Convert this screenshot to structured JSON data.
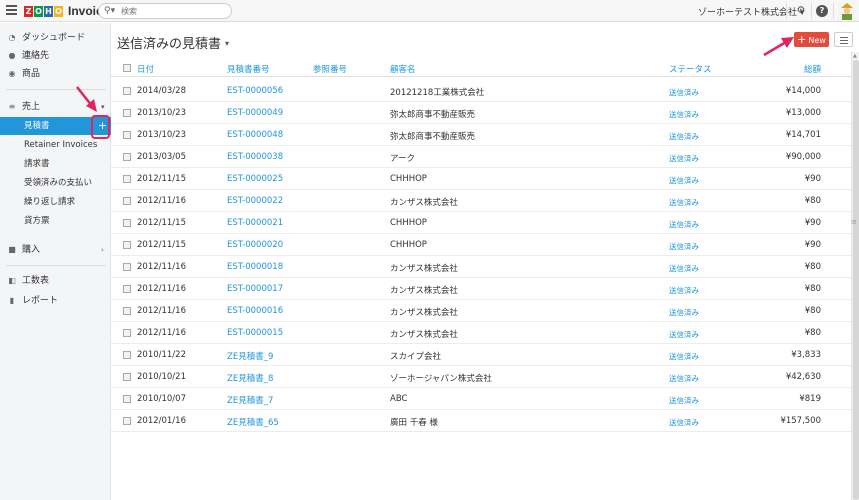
{
  "app": {
    "logo_letters": [
      "Z",
      "O",
      "H",
      "O"
    ],
    "name": "Invoice",
    "logo_colors": [
      "#e42527",
      "#089949",
      "#226db4",
      "#f9b21d"
    ]
  },
  "search": {
    "placeholder": "検索",
    "icon": "search-icon"
  },
  "org": {
    "name": "ゾーホーテスト株式会社 ▾"
  },
  "colors": {
    "accent": "#2196d9",
    "new_button": "#e34b3b",
    "highlight": "#e0245e"
  },
  "sidebar": {
    "items": [
      {
        "label": "ダッシュボード",
        "icon": "dashboard-icon"
      },
      {
        "label": "連絡先",
        "icon": "contacts-icon"
      },
      {
        "label": "商品",
        "icon": "items-icon"
      }
    ],
    "sales": {
      "label": "売上",
      "icon": "sales-icon"
    },
    "sales_sub": [
      "見積書",
      "Retainer Invoices",
      "請求書",
      "受領済みの支払い",
      "繰り返し請求",
      "貸方票"
    ],
    "purchases": {
      "label": "購入",
      "icon": "purchases-icon"
    },
    "timesheet": {
      "label": "工数表",
      "icon": "timesheet-icon"
    },
    "reports": {
      "label": "レポート",
      "icon": "reports-icon"
    }
  },
  "page": {
    "title": "送信済みの見積書",
    "new_label": "New"
  },
  "table": {
    "headers": {
      "date": "日付",
      "number": "見積書番号",
      "reference": "参照番号",
      "customer": "顧客名",
      "status": "ステータス",
      "amount": "総額"
    },
    "rows": [
      {
        "date": "2014/03/28",
        "number": "EST-0000056",
        "customer": "20121218工業株式会社",
        "status": "送信済み",
        "amount": "¥14,000"
      },
      {
        "date": "2013/10/23",
        "number": "EST-0000049",
        "customer": "弥太郎商事不動産販売",
        "status": "送信済み",
        "amount": "¥13,000"
      },
      {
        "date": "2013/10/23",
        "number": "EST-0000048",
        "customer": "弥太郎商事不動産販売",
        "status": "送信済み",
        "amount": "¥14,701"
      },
      {
        "date": "2013/03/05",
        "number": "EST-0000038",
        "customer": "アーク",
        "status": "送信済み",
        "amount": "¥90,000"
      },
      {
        "date": "2012/11/15",
        "number": "EST-0000025",
        "customer": "CHHHOP",
        "status": "送信済み",
        "amount": "¥90"
      },
      {
        "date": "2012/11/16",
        "number": "EST-0000022",
        "customer": "カンザス株式会社",
        "status": "送信済み",
        "amount": "¥80"
      },
      {
        "date": "2012/11/15",
        "number": "EST-0000021",
        "customer": "CHHHOP",
        "status": "送信済み",
        "amount": "¥90"
      },
      {
        "date": "2012/11/15",
        "number": "EST-0000020",
        "customer": "CHHHOP",
        "status": "送信済み",
        "amount": "¥90"
      },
      {
        "date": "2012/11/16",
        "number": "EST-0000018",
        "customer": "カンザス株式会社",
        "status": "送信済み",
        "amount": "¥80"
      },
      {
        "date": "2012/11/16",
        "number": "EST-0000017",
        "customer": "カンザス株式会社",
        "status": "送信済み",
        "amount": "¥80"
      },
      {
        "date": "2012/11/16",
        "number": "EST-0000016",
        "customer": "カンザス株式会社",
        "status": "送信済み",
        "amount": "¥80"
      },
      {
        "date": "2012/11/16",
        "number": "EST-0000015",
        "customer": "カンザス株式会社",
        "status": "送信済み",
        "amount": "¥80"
      },
      {
        "date": "2010/11/22",
        "number": "ZE見積書_9",
        "customer": "スカイプ会社",
        "status": "送信済み",
        "amount": "¥3,833"
      },
      {
        "date": "2010/10/21",
        "number": "ZE見積書_8",
        "customer": "ゾーホージャパン株式会社",
        "status": "送信済み",
        "amount": "¥42,630"
      },
      {
        "date": "2010/10/07",
        "number": "ZE見積書_7",
        "customer": "ABC",
        "status": "送信済み",
        "amount": "¥819"
      },
      {
        "date": "2012/01/16",
        "number": "ZE見積書_65",
        "customer": "廣田 千春 様",
        "status": "送信済み",
        "amount": "¥157,500"
      }
    ]
  }
}
